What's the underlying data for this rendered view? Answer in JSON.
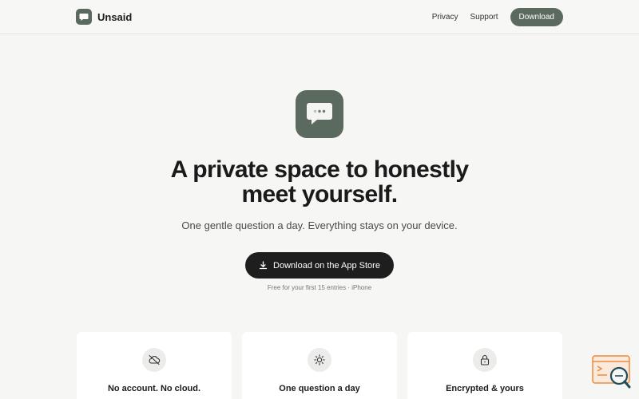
{
  "nav": {
    "brand": "Unsaid",
    "links": [
      "Privacy",
      "Support"
    ],
    "download_label": "Download"
  },
  "hero": {
    "icon": "chat-bubble-icon",
    "headline_line1": "A private space to honestly",
    "headline_line2": "meet yourself.",
    "subline": "One gentle question a day. Everything stays on your device.",
    "cta_label": "Download on the App Store",
    "cta_icon": "download-icon",
    "note": "Free for your first 15 entries · iPhone"
  },
  "features": [
    {
      "title": "No account. No cloud.",
      "icon": "cloud-off-icon"
    },
    {
      "title": "One question a day",
      "icon": "sun-icon"
    },
    {
      "title": "Encrypted & yours",
      "icon": "lock-icon"
    }
  ],
  "colors": {
    "accent": "#5b6a5e",
    "cta": "#1e1e1e",
    "background": "#f6f6f4",
    "badge": "#f08a3c"
  }
}
